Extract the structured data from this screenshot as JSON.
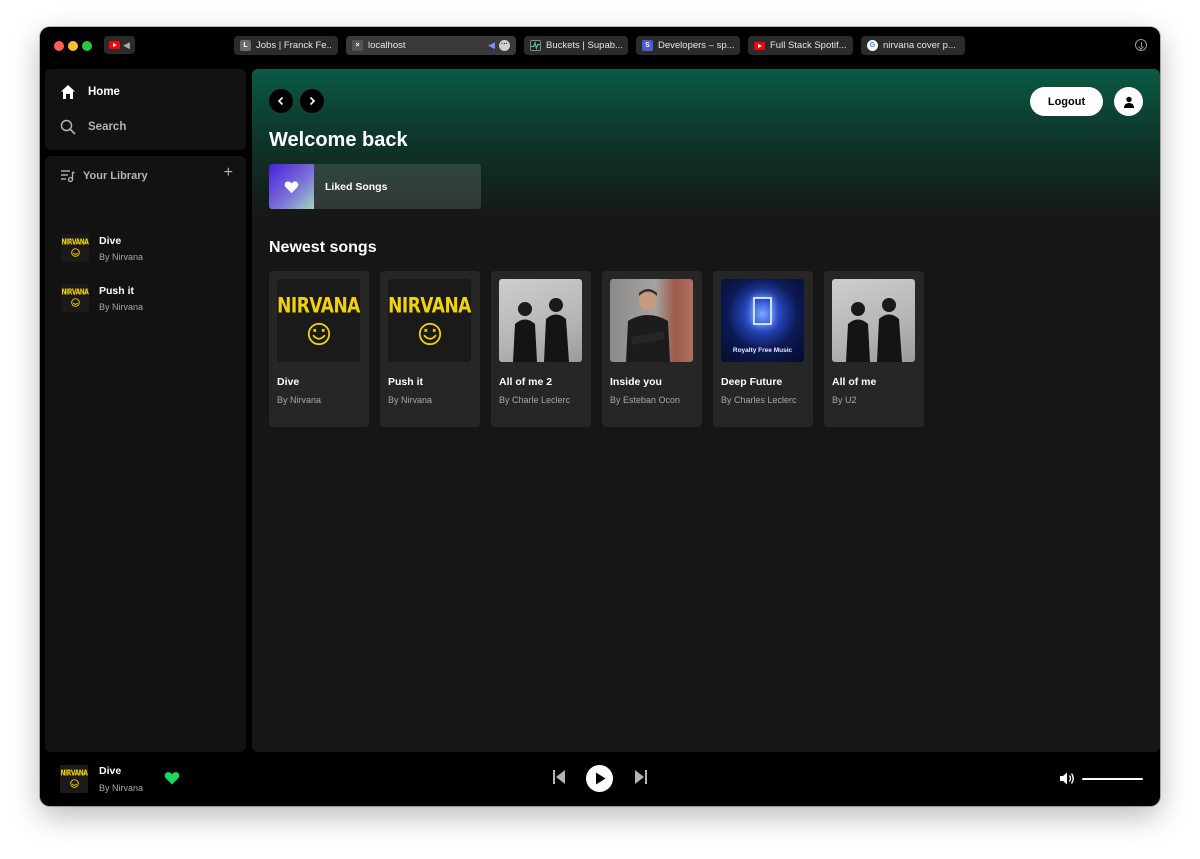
{
  "browser": {
    "tabs": [
      {
        "title": "Jobs | Franck Fe...",
        "favicon": "L",
        "favicon_color": "#6b6b6b"
      },
      {
        "title": "localhost",
        "favicon": "×",
        "favicon_color": "#555555",
        "active": true
      },
      {
        "title": "Buckets | Supab...",
        "favicon": "supabase-icon",
        "favicon_color": "#1f1f1f"
      },
      {
        "title": "Developers – sp...",
        "favicon": "S",
        "favicon_color": "#4f5bd5"
      },
      {
        "title": "Full Stack Spotif...",
        "favicon": "youtube-icon",
        "favicon_color": "#ff0000"
      },
      {
        "title": "nirvana cover p...",
        "favicon": "google-icon",
        "favicon_color": "#ffffff"
      }
    ]
  },
  "sidebar": {
    "nav": [
      {
        "label": "Home",
        "icon": "home-icon"
      },
      {
        "label": "Search",
        "icon": "search-icon"
      }
    ],
    "library": {
      "title": "Your Library",
      "items": [
        {
          "title": "Dive",
          "artist": "By Nirvana"
        },
        {
          "title": "Push it",
          "artist": "By Nirvana"
        }
      ]
    }
  },
  "main": {
    "logout_label": "Logout",
    "welcome": "Welcome back",
    "liked_label": "Liked Songs",
    "newest_title": "Newest songs",
    "songs": [
      {
        "title": "Dive",
        "artist": "By Nirvana",
        "art": "nirvana-logo"
      },
      {
        "title": "Push it",
        "artist": "By Nirvana",
        "art": "nirvana-logo"
      },
      {
        "title": "All of me 2",
        "artist": "By Charle Leclerc",
        "art": "two-people-photo"
      },
      {
        "title": "Inside you",
        "artist": "By Esteban Ocon",
        "art": "man-photo"
      },
      {
        "title": "Deep Future",
        "artist": "By Charles Leclerc",
        "art": "royalty-free-music",
        "art_text": "Royalty Free Music"
      },
      {
        "title": "All of me",
        "artist": "By U2",
        "art": "two-people-photo"
      }
    ]
  },
  "player": {
    "title": "Dive",
    "artist": "By Nirvana",
    "heart_color": "#1ed760",
    "volume": 1.0
  },
  "art_text": {
    "nirvana": "NIRVANA"
  }
}
